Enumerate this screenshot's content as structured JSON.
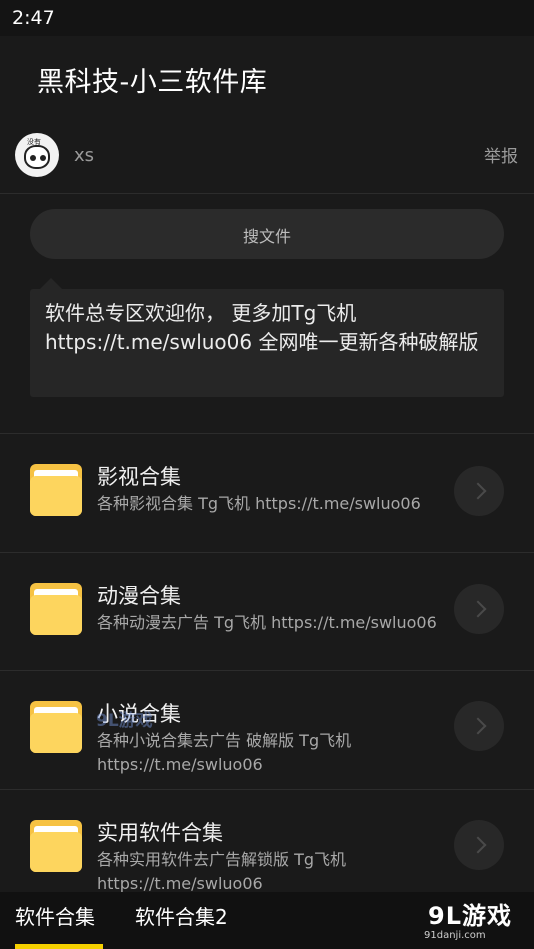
{
  "status": {
    "time": "2:47"
  },
  "app": {
    "title": "黑科技-小三软件库"
  },
  "author": {
    "avatar_tag": "没有",
    "name": "xs",
    "report": "举报"
  },
  "search": {
    "label": "搜文件"
  },
  "notice": {
    "text": "软件总专区欢迎你， 更多加Tg飞机https://t.me/swluo06 全网唯一更新各种破解版"
  },
  "items": [
    {
      "title": "影视合集",
      "desc": "各种影视合集 Tg飞机 https://t.me/swluo06"
    },
    {
      "title": "动漫合集",
      "desc": "各种动漫去广告 Tg飞机 https://t.me/swluo06"
    },
    {
      "title": "小说合集",
      "desc": "各种小说合集去广告 破解版 Tg飞机 https://t.me/swluo06"
    },
    {
      "title": "实用软件合集",
      "desc": "各种实用软件去广告解锁版 Tg飞机 https://t.me/swluo06"
    }
  ],
  "tabs": [
    {
      "label": "软件合集",
      "active": true
    },
    {
      "label": "软件合集2",
      "active": false
    }
  ],
  "watermark": {
    "logo": "9L游戏",
    "url": "91danji.com",
    "center": "9L游戏"
  },
  "colors": {
    "background": "#1a1a1a",
    "accent": "#f5d000",
    "folder": "#f6c243"
  }
}
